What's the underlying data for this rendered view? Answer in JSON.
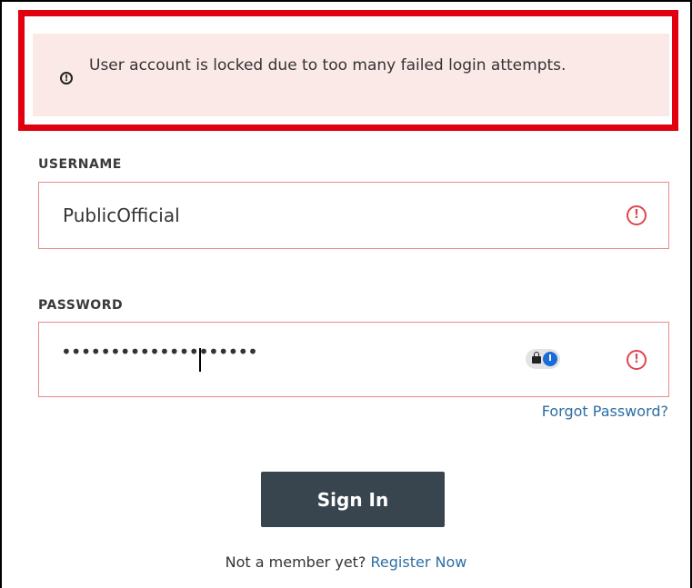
{
  "alert": {
    "icon": "exclamation-circle-icon",
    "message": "User account is locked due to too many failed login attempts.",
    "highlight_color": "#e0000f",
    "background_color": "#fbe9e7"
  },
  "username": {
    "label": "USERNAME",
    "value": "PublicOfficial",
    "error_icon": "error-circle-icon"
  },
  "password": {
    "label": "PASSWORD",
    "masked_value": "••••••••••••••••••••",
    "password_manager_icon": "password-manager-icon",
    "error_icon": "error-circle-icon"
  },
  "forgot_password": "Forgot Password?",
  "sign_in_button": "Sign In",
  "footer": {
    "prompt": "Not a member yet?",
    "register_link": "Register Now"
  },
  "colors": {
    "error": "#e0454f",
    "link": "#2d6ea3",
    "button": "#38454e"
  }
}
